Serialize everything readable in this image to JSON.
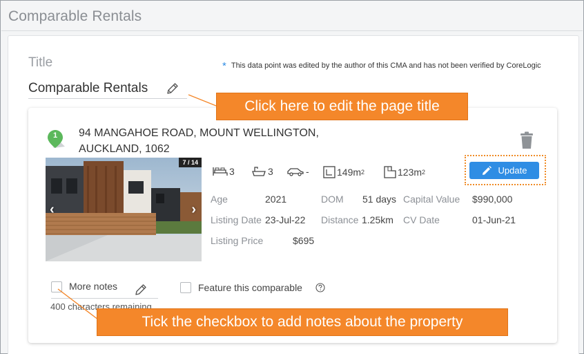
{
  "section": {
    "title": "Comparable Rentals"
  },
  "title_field": {
    "label": "Title",
    "value": "Comparable Rentals",
    "note_star": "*",
    "note": "This data point was edited by the author of this CMA and has not been verified by CoreLogic"
  },
  "property": {
    "marker_number": "1",
    "address_line1": "94 MANGAHOE ROAD, MOUNT WELLINGTON,",
    "address_line2": "AUCKLAND, 1062",
    "photo_counter": "7 / 14",
    "photo_prev": "‹",
    "photo_next": "›",
    "features": {
      "bedrooms": "3",
      "bathrooms": "3",
      "car_spaces": "-",
      "floor_area": "149m",
      "floor_area_sup": "2",
      "land_area": "123m",
      "land_area_sup": "2"
    },
    "details": {
      "age_label": "Age",
      "age_value": "2021",
      "dom_label": "DOM",
      "dom_value": "51 days",
      "capital_value_label": "Capital Value",
      "capital_value_value": "$990,000",
      "listing_date_label": "Listing Date",
      "listing_date_value": "23-Jul-22",
      "distance_label": "Distance",
      "distance_value": "1.25km",
      "cv_date_label": "CV Date",
      "cv_date_value": "01-Jun-21",
      "listing_price_label": "Listing Price",
      "listing_price_value": "$695"
    },
    "update_label": "Update"
  },
  "notes": {
    "more_notes_label": "More notes",
    "chars_remaining": "400 characters remaining",
    "feature_label": "Feature this comparable"
  },
  "callouts": {
    "edit_title": "Click here to edit the page title",
    "tick_checkbox": "Tick the checkbox to add notes about the property"
  },
  "colors": {
    "accent_blue": "#2f8de4",
    "callout_orange": "#f4872a",
    "marker_green": "#5cb85c"
  },
  "icons": [
    "edit-title-icon",
    "map-marker-icon",
    "trash-icon",
    "bed-icon",
    "bath-icon",
    "car-icon",
    "floor-area-icon",
    "land-area-icon",
    "pencil-icon",
    "notes-edit-icon",
    "help-icon"
  ]
}
